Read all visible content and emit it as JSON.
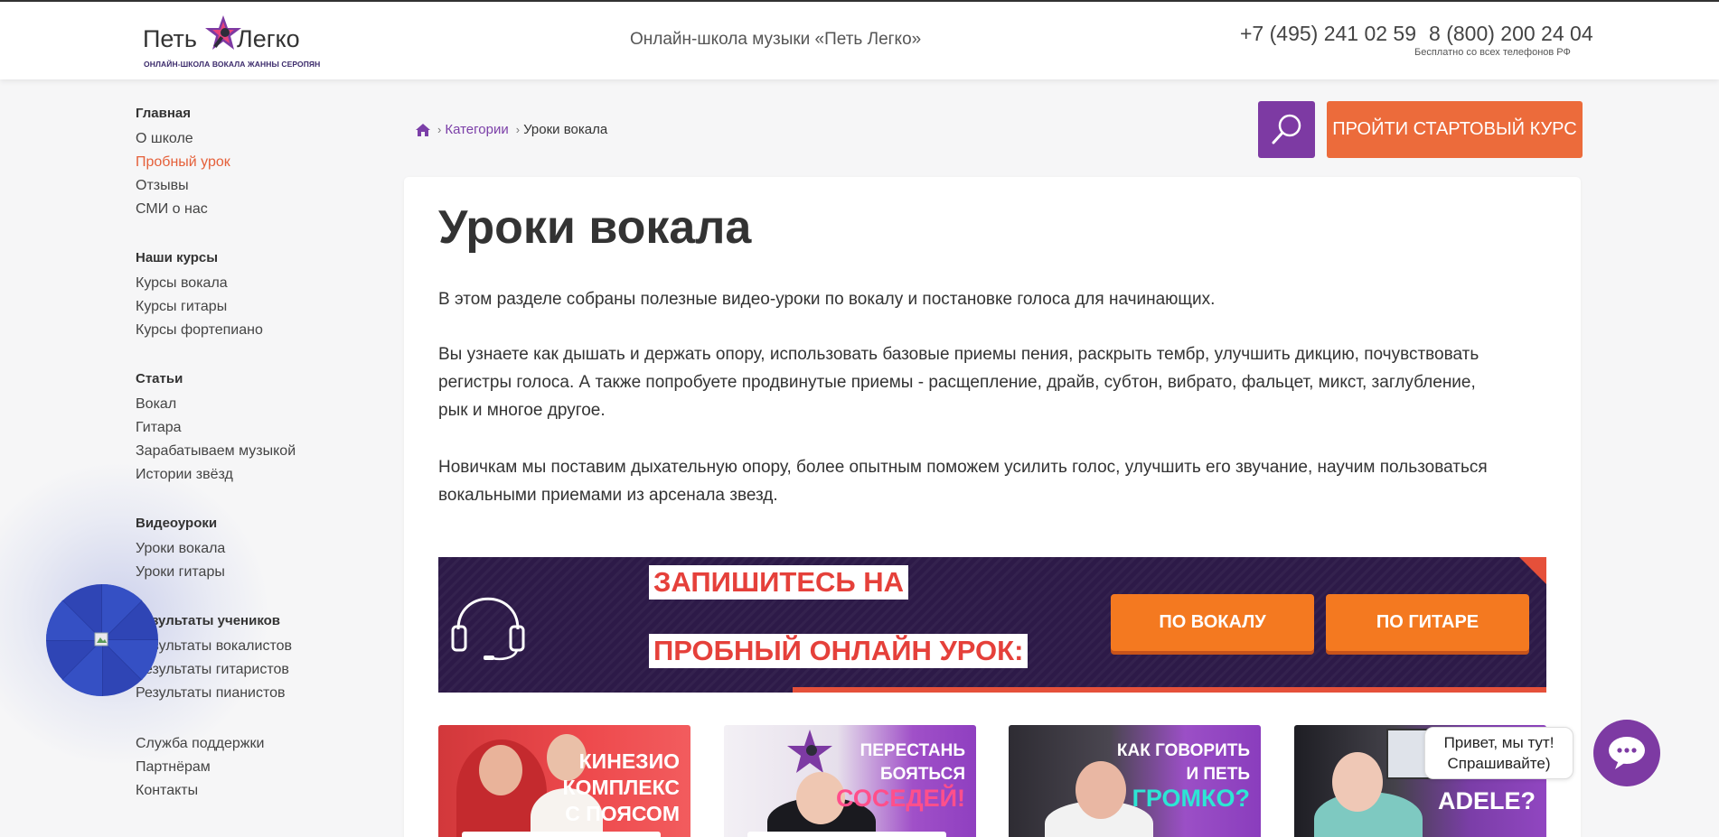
{
  "header": {
    "logo": {
      "word1": "Петь",
      "word2": "Легко",
      "subtitle": "ОНЛАЙН-ШКОЛА ВОКАЛА ЖАННЫ СЕРОПЯН"
    },
    "tagline": "Онлайн-школа музыки «Петь Легко»",
    "phone1": "+7 (495) 241 02 59",
    "phone2": "8 (800) 200 24 04",
    "phone_note": "Бесплатно со всех телефонов РФ"
  },
  "sidebar": {
    "groups": [
      {
        "title": "Главная",
        "items": [
          "О школе",
          "Пробный урок",
          "Отзывы",
          "СМИ о нас"
        ]
      },
      {
        "title": "Наши курсы",
        "items": [
          "Курсы вокала",
          "Курсы гитары",
          "Курсы фортепиано"
        ]
      },
      {
        "title": "Статьи",
        "items": [
          "Вокал",
          "Гитара",
          "Зарабатываем музыкой",
          "Истории звёзд"
        ]
      },
      {
        "title": "Видеоуроки",
        "items": [
          "Уроки вокала",
          "Уроки гитары"
        ]
      },
      {
        "title": "Результаты учеников",
        "items": [
          "Результаты вокалистов",
          "Результаты гитаристов",
          "Результаты пианистов"
        ]
      },
      {
        "title": "",
        "items": [
          "Служба поддержки",
          "Партнёрам",
          "Контакты"
        ]
      }
    ],
    "active_item": "Пробный урок"
  },
  "breadcrumb": {
    "home_icon": "home-icon",
    "items": [
      "Категории",
      "Уроки вокала"
    ]
  },
  "actions": {
    "search_icon": "search-icon",
    "cta_label": "ПРОЙТИ СТАРТОВЫЙ КУРС"
  },
  "main": {
    "title": "Уроки вокала",
    "paragraphs": [
      "В этом разделе собраны полезные видео-уроки по вокалу и постановке голоса для начинающих.",
      "Вы узнаете как дышать и держать опору, использовать базовые приемы пения, раскрыть тембр, улучшить дикцию, почувствовать регистры голоса. А также попробуете продвинутые приемы - расщепление, драйв, субтон, вибрато, фальцет, микст, заглубление, рык и многое другое.",
      "Новичкам мы поставим дыхательную опору, более опытным поможем усилить голос, улучшить его звучание, научим пользоваться вокальными приемами из арсенала звезд."
    ]
  },
  "banner": {
    "icon": "headphones-icon",
    "line1": "ЗАПИШИТЕСЬ НА",
    "line2": "ПРОБНЫЙ ОНЛАЙН УРОК:",
    "button_vocal": "ПО ВОКАЛУ",
    "button_guitar": "ПО ГИТАРЕ"
  },
  "videos": [
    {
      "lines": [
        "КИНЕЗИО",
        "КОМПЛЕКС",
        "С ПОЯСОМ"
      ],
      "highlight": ""
    },
    {
      "lines": [
        "ПЕРЕСТАНЬ",
        "БОЯТЬСЯ"
      ],
      "highlight": "СОСЕДЕЙ!"
    },
    {
      "lines": [
        "КАК ГОВОРИТЬ",
        "И ПЕТЬ"
      ],
      "highlight": "ГРОМКО?"
    },
    {
      "lines": [],
      "highlight": "ADELE?"
    }
  ],
  "chat": {
    "line1": "Привет, мы тут!",
    "line2": "Спрашивайте)",
    "icon": "chat-icon"
  },
  "colors": {
    "brand_purple": "#7d3aa3",
    "accent_orange": "#ec6b3b",
    "active_link": "#e5603a",
    "banner_bg": "#2d1a48",
    "banner_button": "#f47920"
  }
}
